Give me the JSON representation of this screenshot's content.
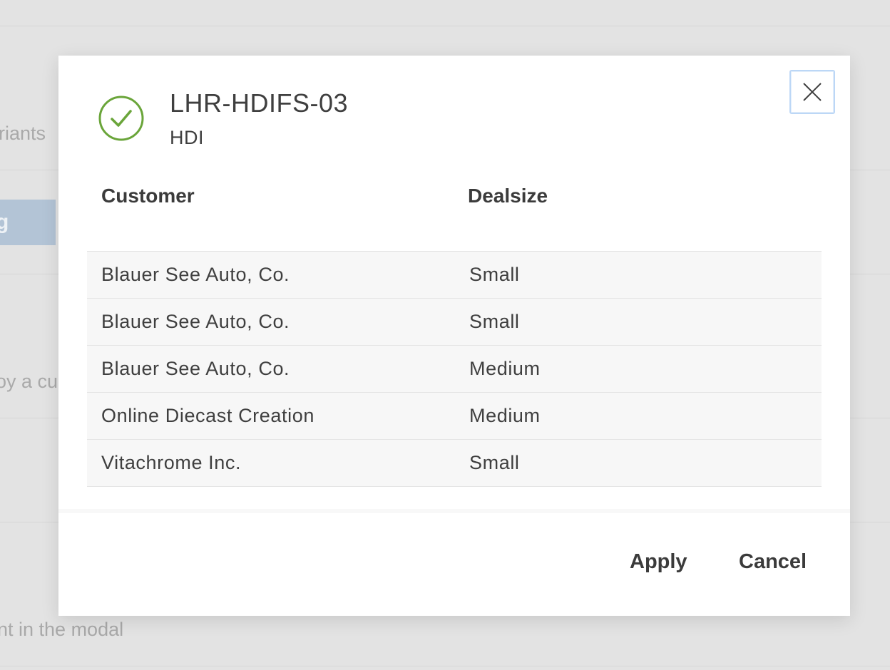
{
  "background": {
    "text_fragments": [
      "riants",
      "oy a cu",
      "nt in the modal"
    ],
    "button_fragment": "g"
  },
  "modal": {
    "title": "LHR-HDIFS-03",
    "subtitle": "HDI",
    "status_icon": "check-circle-icon",
    "status_color": "#6aa53a",
    "close_icon": "close-icon",
    "table": {
      "columns": [
        "Customer",
        "Dealsize"
      ],
      "rows": [
        {
          "customer": "Blauer See Auto, Co.",
          "dealsize": "Small"
        },
        {
          "customer": "Blauer See Auto, Co.",
          "dealsize": "Small"
        },
        {
          "customer": "Blauer See Auto, Co.",
          "dealsize": "Medium"
        },
        {
          "customer": "Online Diecast Creation",
          "dealsize": "Medium"
        },
        {
          "customer": "Vitachrome Inc.",
          "dealsize": "Small"
        }
      ]
    },
    "footer": {
      "apply_label": "Apply",
      "cancel_label": "Cancel"
    }
  }
}
